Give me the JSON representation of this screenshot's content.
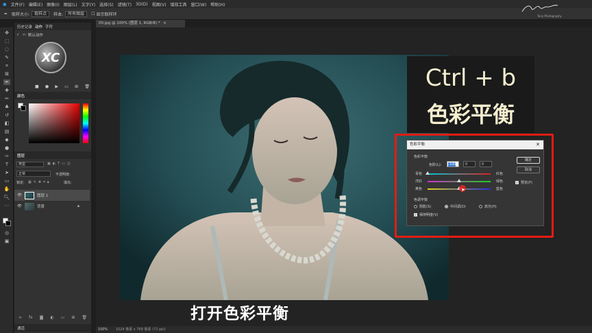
{
  "menubar": {
    "items": [
      "文件(F)",
      "编辑(E)",
      "图像(I)",
      "图层(L)",
      "文字(Y)",
      "选择(S)",
      "滤镜(T)",
      "3D(D)",
      "视图(V)",
      "增效工具",
      "窗口(W)",
      "帮助(H)"
    ]
  },
  "optionsbar": {
    "sample_size_label": "取样大小:",
    "sample_size_value": "取样点",
    "sample_label": "样本:",
    "sample_value": "所有图层",
    "show_ring_label": "显示取样环"
  },
  "brand": {
    "signature": "Tony Photography"
  },
  "document_tab": {
    "title": "00.jpg @ 100% (图层 1, RGB/8) *"
  },
  "history_panel": {
    "tabs": [
      "历史记录",
      "动作",
      "字符"
    ],
    "action_set": "默认动作",
    "logo_text": "XC"
  },
  "color_panel": {
    "tab": "颜色"
  },
  "layers_panel": {
    "tab": "图层",
    "kind_label": "类型",
    "mode_value": "正常",
    "opacity_label": "不透明度:",
    "lock_label": "锁定:",
    "fill_label": "填充:",
    "layers": [
      {
        "name": "图层 1"
      },
      {
        "name": "背景"
      }
    ]
  },
  "channels_tab": "通道",
  "overlay": {
    "shortcut": "Ctrl + b",
    "shortcut_name": "色彩平衡",
    "subtitle": "打开色彩平衡"
  },
  "colors": {
    "highlight_red": "#e51c12",
    "overlay_text": "#f6efcf"
  },
  "dialog": {
    "title": "色彩平衡",
    "group_color_balance": "色彩平衡",
    "levels_label": "色阶(L):",
    "levels": [
      "-100",
      "0",
      "0"
    ],
    "sliders": [
      {
        "left": "青色",
        "right": "红色",
        "value": -100
      },
      {
        "left": "洋红",
        "right": "绿色",
        "value": 0
      },
      {
        "left": "黄色",
        "right": "蓝色",
        "value": 0
      }
    ],
    "group_tone_balance": "色调平衡",
    "tones": [
      "阴影(S)",
      "中间调(D)",
      "高光(H)"
    ],
    "selected_tone": "中间调(D)",
    "preserve_luminosity": "保持明度(V)",
    "ok_button": "确定",
    "cancel_button": "取消",
    "preview_label": "预览(P)"
  },
  "statusbar": {
    "zoom": "100%",
    "doc_info": "1024 像素 x 768 像素 (72 ppi)"
  }
}
